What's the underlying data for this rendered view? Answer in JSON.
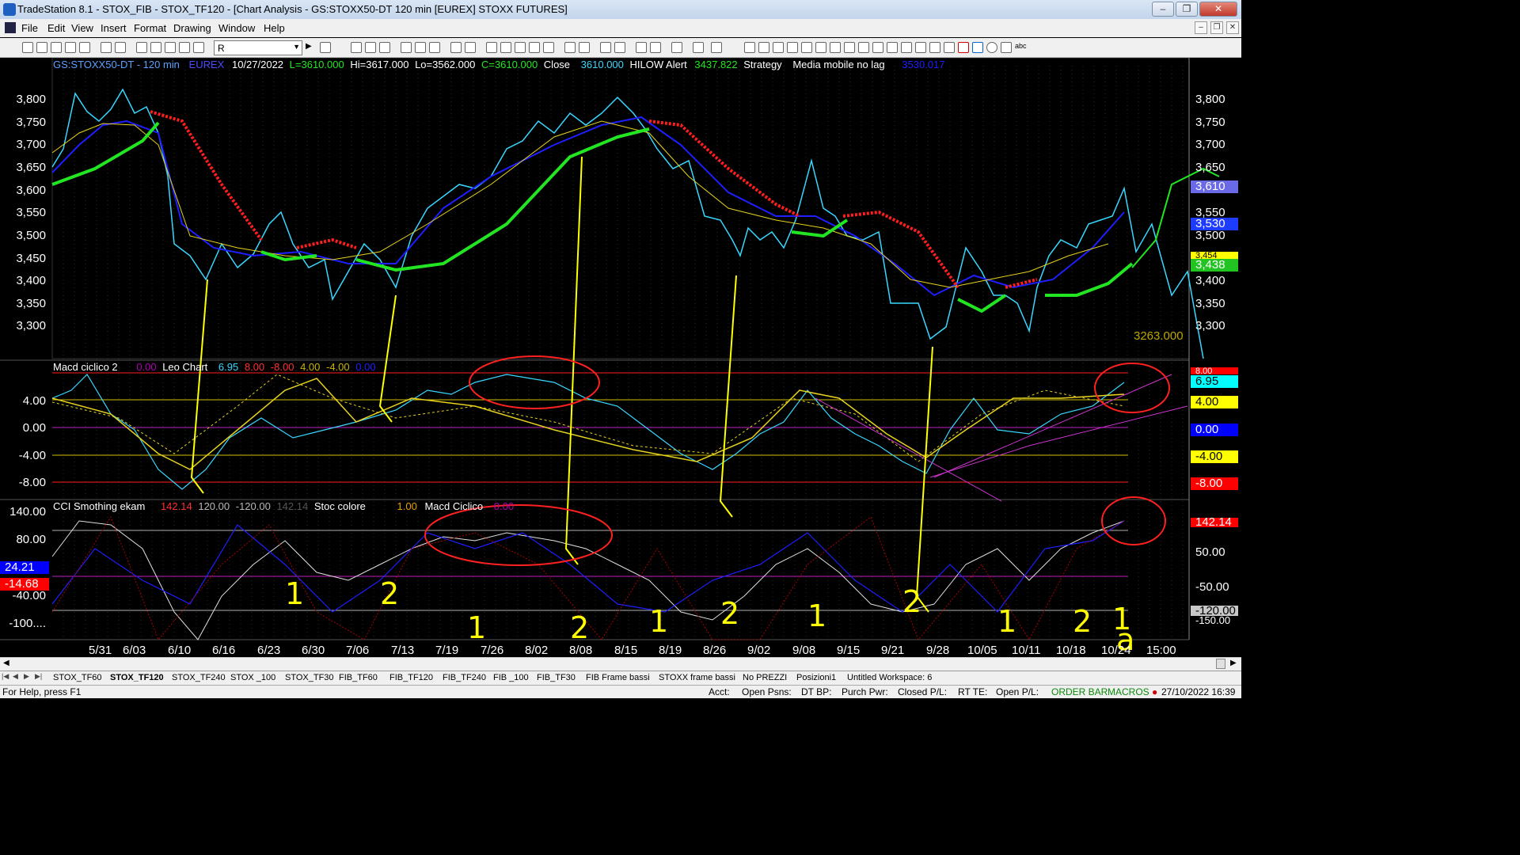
{
  "window": {
    "title": "TradeStation 8.1 - STOX_FIB - STOX_TF120 - [Chart Analysis - GS:STOXX50-DT  120 min  [EUREX] STOXX FUTURES]",
    "minimize": "‒",
    "maximize": "❐",
    "close": "✕"
  },
  "menu": [
    "File",
    "Edit",
    "View",
    "Insert",
    "Format",
    "Drawing",
    "Window",
    "Help"
  ],
  "toolbar": {
    "symbol_value": "R"
  },
  "chart": {
    "header": {
      "symbol": "GS:STOXX50-DT - 120 min",
      "exchange": "EUREX",
      "date": "10/27/2022",
      "low": "L=3610.000",
      "high": "Hi=3617.000",
      "lo": "Lo=3562.000",
      "close_c": "C=3610.000",
      "close_label": "Close",
      "close_value": "3610.000",
      "hilow_label": "HILOW Alert",
      "hilow_value": "3437.822",
      "strategy": "Strategy",
      "media": "Media mobile no lag",
      "media_value": "3530.017"
    },
    "price_axis": [
      "3,800",
      "3,750",
      "3,700",
      "3,650",
      "3,600",
      "3,550",
      "3,500",
      "3,450",
      "3,400",
      "3,350",
      "3,300"
    ],
    "price_tags": [
      {
        "text": "3,610",
        "bg": "#6a6ae6",
        "color": "#ffffff"
      },
      {
        "text": "3,530",
        "bg": "#1e3cff",
        "color": "#ffffff"
      },
      {
        "text": "3,454",
        "bg": "#ffff00",
        "color": "#000000"
      },
      {
        "text": "3,438",
        "bg": "#22c422",
        "color": "#ffffff"
      }
    ],
    "level_label": "3263.000",
    "macd_panel": {
      "title": "Macd ciclico 2",
      "v0": "0.00",
      "name2": "Leo Chart",
      "v1": "6.95",
      "v2": "8.00",
      "v3": "-8.00",
      "v4": "4.00",
      "v5": "-4.00",
      "v6": "0.00",
      "axis": [
        "4.00",
        "0.00",
        "-4.00",
        "-8.00"
      ],
      "tags": [
        {
          "text": "8.00",
          "bg": "#ff0000",
          "color": "#ffffff"
        },
        {
          "text": "6.95",
          "bg": "#00ffff",
          "color": "#000000"
        },
        {
          "text": "4.00",
          "bg": "#ffff00",
          "color": "#000000"
        },
        {
          "text": "0.00",
          "bg": "#0000ff",
          "color": "#ffffff"
        },
        {
          "text": "-4.00",
          "bg": "#ffff00",
          "color": "#000000"
        },
        {
          "text": "-8.00",
          "bg": "#ff0000",
          "color": "#ffffff"
        }
      ]
    },
    "cci_panel": {
      "title": "CCI Smothing ekam",
      "v1": "142.14",
      "v2": "120.00",
      "v3": "-120.00",
      "v4": "142.14",
      "stoc": "Stoc colore",
      "stoc_value": "1.00",
      "macd": "Macd Ciclico",
      "macd_value": "0.00",
      "axis_left": [
        "140.00",
        "80.00",
        "-40.00",
        "-100...."
      ],
      "axis_right": [
        "120.00",
        "50.00",
        "-50.00",
        "-150.00"
      ],
      "left_tags": [
        {
          "text": "24.21",
          "bg": "#0000ff",
          "color": "#ffffff"
        },
        {
          "text": "-14.68",
          "bg": "#ff0000",
          "color": "#ffffff"
        }
      ],
      "right_tags": [
        {
          "text": "142.14",
          "bg": "#ff0000",
          "color": "#ffffff"
        },
        {
          "text": "-120.00",
          "bg": "#c8c8c8",
          "color": "#000000"
        }
      ]
    },
    "x_axis": [
      "5/31",
      "6/03",
      "6/10",
      "6/16",
      "6/23",
      "6/30",
      "7/06",
      "7/13",
      "7/19",
      "7/26",
      "8/02",
      "8/08",
      "8/15",
      "8/19",
      "8/26",
      "9/02",
      "9/08",
      "9/15",
      "9/21",
      "9/28",
      "10/05",
      "10/11",
      "10/18",
      "10/24",
      "15:00"
    ],
    "annotations": [
      "1",
      "2",
      "1",
      "2",
      "1",
      "2",
      "1",
      "2",
      "1",
      "2",
      "1",
      "2",
      "2",
      "a"
    ],
    "colors": {
      "price_line": "#39d7ff",
      "ma_blue": "#1e1eff",
      "ma_yellow": "#e6d21e",
      "green": "#22e622",
      "red": "#ff1e1e",
      "magenta": "#cc33cc"
    }
  },
  "tabs": [
    "STOX_TF60",
    "STOX_TF120",
    "STOX_TF240",
    "STOX _100",
    "STOX_TF30",
    "FIB_TF60",
    "FIB_TF120",
    "FIB_TF240",
    "FIB _100",
    "FIB_TF30",
    "FIB Frame bassi",
    "STOXX frame bassi",
    "No PREZZI",
    "Posizioni1",
    "Untitled Workspace: 6"
  ],
  "active_tab": "STOX_TF120",
  "status": {
    "help": "For Help, press F1",
    "acct": "Acct:",
    "open_psns": "Open Psns:",
    "dt_bp": "DT BP:",
    "purch_pwr": "Purch Pwr:",
    "closed_pl": "Closed P/L:",
    "rt_te": "RT TE:",
    "open_pl": "Open P/L:",
    "order_bar": "ORDER BAR",
    "macros": "MACROS",
    "datetime": "27/10/2022 16:39"
  }
}
